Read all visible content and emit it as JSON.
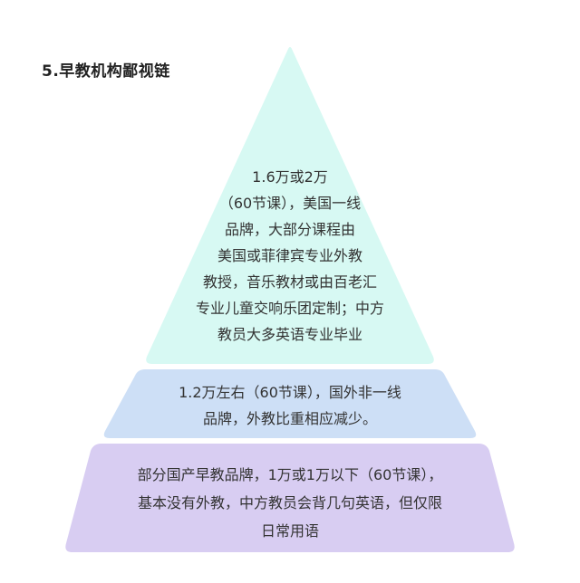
{
  "title": "5.早教机构鄙视链",
  "colors": {
    "top_tier": "#d7f9f3",
    "middle_tier": "#cddff6",
    "bottom_tier": "#d8cdf2",
    "text": "#333333"
  },
  "tiers": {
    "top": {
      "lines": [
        "1.6万或2万",
        "（60节课），美国一线",
        "品牌，大部分课程由",
        "美国或菲律宾专业外教",
        "教授，音乐教材或由百老汇",
        "专业儿童交响乐团定制；中方",
        "教员大多英语专业毕业"
      ]
    },
    "middle": {
      "lines": [
        "1.2万左右（60节课），国外非一线",
        "品牌，外教比重相应减少。"
      ]
    },
    "bottom": {
      "lines": [
        "部分国产早教品牌，1万或1万以下（60节课），",
        "基本没有外教，中方教员会背几句英语，但仅限",
        "日常用语"
      ]
    }
  }
}
